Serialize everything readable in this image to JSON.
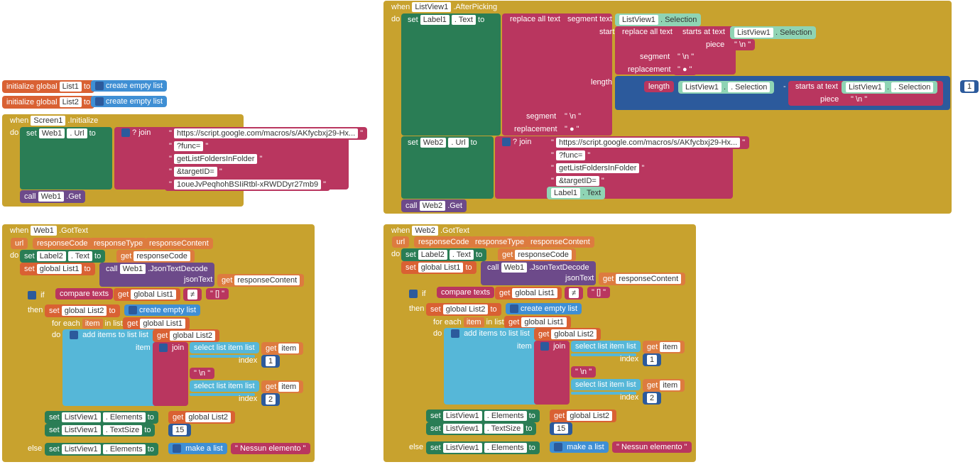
{
  "init1": {
    "t": "initialize global",
    "var": "List1",
    "to": "to",
    "make": "create empty list"
  },
  "init2": {
    "t": "initialize global",
    "var": "List2",
    "to": "to",
    "make": "create empty list"
  },
  "screen": {
    "when": "when",
    "comp": "Screen1",
    "ev": ".Initialize",
    "do": "do",
    "set": "set",
    "web": "Web1",
    "prop": ". Url",
    "to": "to",
    "join": "join",
    "s1": "https://script.google.com/macros/s/AKfycbxj29-Hx...",
    "s2": "?func=",
    "s3": "getListFoldersInFolder",
    "s4": "&targetID=",
    "s5": "1oueJvPeqhohBSIiRtbl-xRWDDyr27mb9",
    "call": "call",
    "web2": "Web1",
    "get": ".Get"
  },
  "after": {
    "when": "when",
    "comp": "ListView1",
    "ev": ".AfterPicking",
    "do": "do",
    "set": "set",
    "lbl": "Label1",
    "prop": ". Text",
    "to": "to",
    "repl": "replace all text",
    "seg": "segment  text",
    "lv": "ListView1",
    "sel": ". Selection",
    "start": "start",
    "startsat": "starts at  text",
    "piece": "piece",
    "nl": "\" \\n \"",
    "segment": "segment",
    "dot": "\" ● \"",
    "replacement": "replacement",
    "length": "length",
    "len": "length",
    "plus": "+",
    "one": "1",
    "minus": "-",
    "set2": "set",
    "w2": "Web2",
    "url": ". Url",
    "to2": "to",
    "join": "join",
    "s1": "https://script.google.com/macros/s/AKfycbxj29-Hx...",
    "s2": "?func=",
    "s3": "getListFoldersInFolder",
    "s4": "&targetID=",
    "lbl2": "Label1",
    "txt": ". Text",
    "call": "call",
    "w2b": "Web2",
    "get": ".Get"
  },
  "got1": {
    "when": "when",
    "comp": "Web1",
    "ev": ".GotText",
    "p1": "url",
    "p2": "responseCode",
    "p3": "responseType",
    "p4": "responseContent",
    "do": "do",
    "set1": "set",
    "l2": "Label2",
    "txt": ". Text",
    "to": "to",
    "get": "get",
    "rc": "responseCode",
    "set2": "set",
    "gl1": "global List1",
    "to2": "to",
    "call": "call",
    "w": "Web1",
    "jd": ".JsonTextDecode",
    "jt": "jsonText",
    "get2": "get",
    "rcont": "responseContent",
    "if": "if",
    "cmp": "compare texts",
    "get3": "get",
    "gl1b": "global List1",
    "neq": "≠",
    "empty": "\" [] \"",
    "then": "then",
    "set3": "set",
    "gl2": "global List2",
    "to3": "to",
    "cel": "create empty list",
    "fore": "for each",
    "item": "item",
    "inl": "in list",
    "get4": "get",
    "gl1c": "global List1",
    "do2": "do",
    "add": "add items to list   list",
    "get5": "get",
    "gl2b": "global List2",
    "itemlbl": "item",
    "join": "join",
    "sel": "select list item  list",
    "get6": "get",
    "it": "item",
    "idx": "index",
    "one": "1",
    "nl": "\" \\n \"",
    "sel2": "select list item  list",
    "get7": "get",
    "it2": "item",
    "two": "2",
    "set4": "set",
    "lv": "ListView1",
    "el": ". Elements",
    "to4": "to",
    "get8": "get",
    "gl2c": "global List2",
    "set5": "set",
    "lv2": "ListView1",
    "ts": ". TextSize",
    "to5": "to",
    "fifteen": "15",
    "else": "else",
    "set6": "set",
    "lv3": "ListView1",
    "el2": ". Elements",
    "to6": "to",
    "mal": "make a list",
    "ne": "\" Nessun elemento \""
  },
  "got2": {
    "when": "when",
    "comp": "Web2",
    "ev": ".GotText",
    "p1": "url",
    "p2": "responseCode",
    "p3": "responseType",
    "p4": "responseContent",
    "do": "do",
    "set1": "set",
    "l2": "Label2",
    "txt": ". Text",
    "to": "to",
    "get": "get",
    "rc": "responseCode",
    "set2": "set",
    "gl1": "global List1",
    "to2": "to",
    "call": "call",
    "w": "Web1",
    "jd": ".JsonTextDecode",
    "jt": "jsonText",
    "get2": "get",
    "rcont": "responseContent",
    "if": "if",
    "cmp": "compare texts",
    "get3": "get",
    "gl1b": "global List1",
    "neq": "≠",
    "empty": "\" [] \"",
    "then": "then",
    "set3": "set",
    "gl2": "global List2",
    "to3": "to",
    "cel": "create empty list",
    "fore": "for each",
    "item": "item",
    "inl": "in list",
    "get4": "get",
    "gl1c": "global List1",
    "do2": "do",
    "add": "add items to list   list",
    "get5": "get",
    "gl2b": "global List2",
    "itemlbl": "item",
    "join": "join",
    "sel": "select list item  list",
    "get6": "get",
    "it": "item",
    "idx": "index",
    "one": "1",
    "nl": "\" \\n \"",
    "sel2": "select list item  list",
    "get7": "get",
    "it2": "item",
    "two": "2",
    "set4": "set",
    "lv": "ListView1",
    "el": ". Elements",
    "to4": "to",
    "get8": "get",
    "gl2c": "global List2",
    "set5": "set",
    "lv2": "ListView1",
    "ts": ". TextSize",
    "to5": "to",
    "fifteen": "15",
    "else": "else",
    "set6": "set",
    "lv3": "ListView1",
    "el2": ". Elements",
    "to6": "to",
    "mal": "make a list",
    "ne": "\" Nessun elemento \""
  }
}
